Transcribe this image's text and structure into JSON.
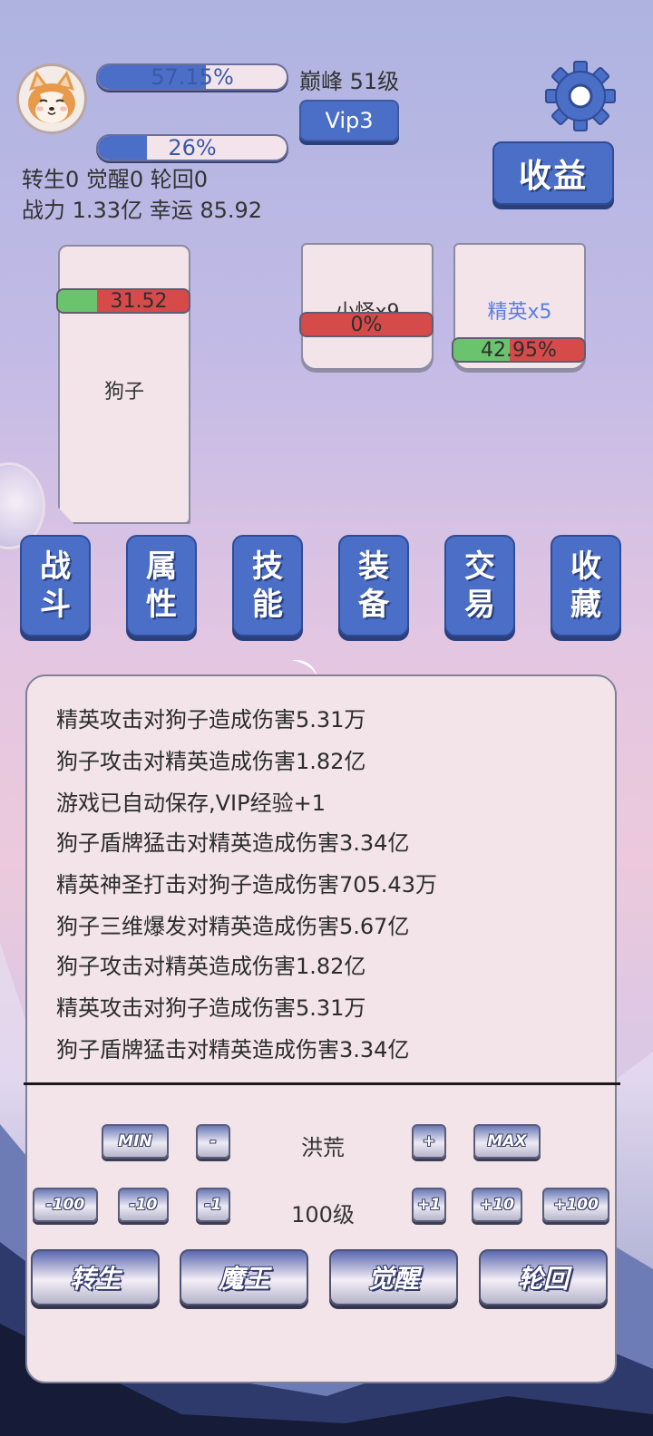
{
  "header": {
    "exp_bar": {
      "text": "57.15%",
      "fraction": 0.5715
    },
    "level_text": "巅峰 51级",
    "vip_bar": {
      "text": "26%",
      "fraction": 0.26
    },
    "vip_label": "Vip3",
    "income_label": "收益",
    "stats_line1": "转生0 觉醒0 轮回0",
    "stats_line2": "战力 1.33亿  幸运 85.92"
  },
  "player_card": {
    "hp_text": "31.52",
    "hp_fraction": 0.3,
    "name": "狗子"
  },
  "enemy_cards": [
    {
      "hp_text": "0%",
      "hp_fraction": 0.0,
      "name": "小怪x9",
      "name_color": "#333333"
    },
    {
      "hp_text": "42.95%",
      "hp_fraction": 0.4295,
      "name": "精英x5",
      "name_color": "#5b7ee0"
    }
  ],
  "tabs": [
    {
      "top": "战",
      "bottom": "斗"
    },
    {
      "top": "属",
      "bottom": "性"
    },
    {
      "top": "技",
      "bottom": "能"
    },
    {
      "top": "装",
      "bottom": "备"
    },
    {
      "top": "交",
      "bottom": "易"
    },
    {
      "top": "收",
      "bottom": "藏"
    }
  ],
  "log": [
    "精英攻击对狗子造成伤害5.31万",
    "狗子攻击对精英造成伤害1.82亿",
    "游戏已自动保存,VIP经验+1",
    "狗子盾牌猛击对精英造成伤害3.34亿",
    "精英神圣打击对狗子造成伤害705.43万",
    "狗子三维爆发对精英造成伤害5.67亿",
    "狗子攻击对精英造成伤害1.82亿",
    "精英攻击对狗子造成伤害5.31万",
    "狗子盾牌猛击对精英造成伤害3.34亿"
  ],
  "difficulty": {
    "min": "MIN",
    "minus": "-",
    "label": "洪荒",
    "plus": "+",
    "max": "MAX"
  },
  "level_select": {
    "m100": "-100",
    "m10": "-10",
    "m1": "-1",
    "label": "100级",
    "p1": "+1",
    "p10": "+10",
    "p100": "+100"
  },
  "actions": [
    "转生",
    "魔王",
    "觉醒",
    "轮回"
  ],
  "colors": {
    "accent": "#4b6ec6",
    "hp_red": "#d64a4a",
    "hp_green": "#6cc36e",
    "panel": "#f2e4e8"
  }
}
